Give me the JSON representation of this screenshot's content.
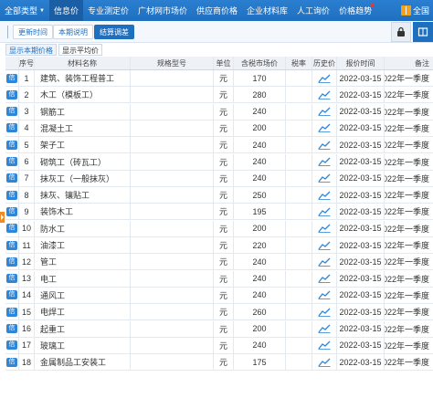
{
  "nav": {
    "items": [
      {
        "label": "全部类型",
        "dropdown": true,
        "active": false
      },
      {
        "label": "信息价",
        "dropdown": false,
        "active": true
      },
      {
        "label": "专业测定价",
        "dropdown": false,
        "active": false
      },
      {
        "label": "广材网市场价",
        "dropdown": false,
        "active": false
      },
      {
        "label": "供应商价格",
        "dropdown": false,
        "active": false
      },
      {
        "label": "企业材料库",
        "dropdown": false,
        "active": false
      },
      {
        "label": "人工询价",
        "dropdown": false,
        "active": false
      },
      {
        "label": "价格趋势",
        "dropdown": false,
        "active": false,
        "dot": true
      }
    ],
    "region_label": "全国",
    "colors": {
      "nav_bg": "#1f6fbf",
      "accent": "#f08a24"
    }
  },
  "toolbar": {
    "buttons": [
      {
        "label": "更新时间",
        "active": false
      },
      {
        "label": "本期说明",
        "active": false
      },
      {
        "label": "结算调差",
        "active": true
      }
    ],
    "icons": [
      "lock-icon",
      "book-icon"
    ]
  },
  "subbar": {
    "show_current_label": "显示本期价格",
    "show_avg_label": "显示平均价"
  },
  "table": {
    "headers": {
      "no": "序号",
      "name": "材料名称",
      "spec": "规格型号",
      "unit": "单位",
      "price": "含税市场价",
      "tax": "税率",
      "hist": "历史价",
      "time": "报价时间",
      "note": "备注"
    },
    "info_badge": "信",
    "rows": [
      {
        "no": "1",
        "name": "建筑、装饰工程普工",
        "spec": "",
        "unit": "元",
        "price": "170",
        "tax": "",
        "time": "2022-03-15",
        "note": "2022年一季度"
      },
      {
        "no": "2",
        "name": "木工（模板工）",
        "spec": "",
        "unit": "元",
        "price": "280",
        "tax": "",
        "time": "2022-03-15",
        "note": "2022年一季度"
      },
      {
        "no": "3",
        "name": "钢筋工",
        "spec": "",
        "unit": "元",
        "price": "240",
        "tax": "",
        "time": "2022-03-15",
        "note": "2022年一季度"
      },
      {
        "no": "4",
        "name": "混凝土工",
        "spec": "",
        "unit": "元",
        "price": "200",
        "tax": "",
        "time": "2022-03-15",
        "note": "2022年一季度"
      },
      {
        "no": "5",
        "name": "架子工",
        "spec": "",
        "unit": "元",
        "price": "240",
        "tax": "",
        "time": "2022-03-15",
        "note": "2022年一季度"
      },
      {
        "no": "6",
        "name": "砌筑工（砖瓦工）",
        "spec": "",
        "unit": "元",
        "price": "240",
        "tax": "",
        "time": "2022-03-15",
        "note": "2022年一季度"
      },
      {
        "no": "7",
        "name": "抹灰工（一般抹灰）",
        "spec": "",
        "unit": "元",
        "price": "240",
        "tax": "",
        "time": "2022-03-15",
        "note": "2022年一季度"
      },
      {
        "no": "8",
        "name": "抹灰、镶贴工",
        "spec": "",
        "unit": "元",
        "price": "250",
        "tax": "",
        "time": "2022-03-15",
        "note": "2022年一季度"
      },
      {
        "no": "9",
        "name": "装饰木工",
        "spec": "",
        "unit": "元",
        "price": "195",
        "tax": "",
        "time": "2022-03-15",
        "note": "2022年一季度"
      },
      {
        "no": "10",
        "name": "防水工",
        "spec": "",
        "unit": "元",
        "price": "200",
        "tax": "",
        "time": "2022-03-15",
        "note": "2022年一季度"
      },
      {
        "no": "11",
        "name": "油漆工",
        "spec": "",
        "unit": "元",
        "price": "220",
        "tax": "",
        "time": "2022-03-15",
        "note": "2022年一季度"
      },
      {
        "no": "12",
        "name": "管工",
        "spec": "",
        "unit": "元",
        "price": "240",
        "tax": "",
        "time": "2022-03-15",
        "note": "2022年一季度"
      },
      {
        "no": "13",
        "name": "电工",
        "spec": "",
        "unit": "元",
        "price": "240",
        "tax": "",
        "time": "2022-03-15",
        "note": "2022年一季度"
      },
      {
        "no": "14",
        "name": "通风工",
        "spec": "",
        "unit": "元",
        "price": "240",
        "tax": "",
        "time": "2022-03-15",
        "note": "2022年一季度"
      },
      {
        "no": "15",
        "name": "电焊工",
        "spec": "",
        "unit": "元",
        "price": "260",
        "tax": "",
        "time": "2022-03-15",
        "note": "2022年一季度"
      },
      {
        "no": "16",
        "name": "起重工",
        "spec": "",
        "unit": "元",
        "price": "200",
        "tax": "",
        "time": "2022-03-15",
        "note": "2022年一季度"
      },
      {
        "no": "17",
        "name": "玻璃工",
        "spec": "",
        "unit": "元",
        "price": "240",
        "tax": "",
        "time": "2022-03-15",
        "note": "2022年一季度"
      },
      {
        "no": "18",
        "name": "金属制品工安装工",
        "spec": "",
        "unit": "元",
        "price": "175",
        "tax": "",
        "time": "2022-03-15",
        "note": "2022年一季度"
      }
    ]
  }
}
